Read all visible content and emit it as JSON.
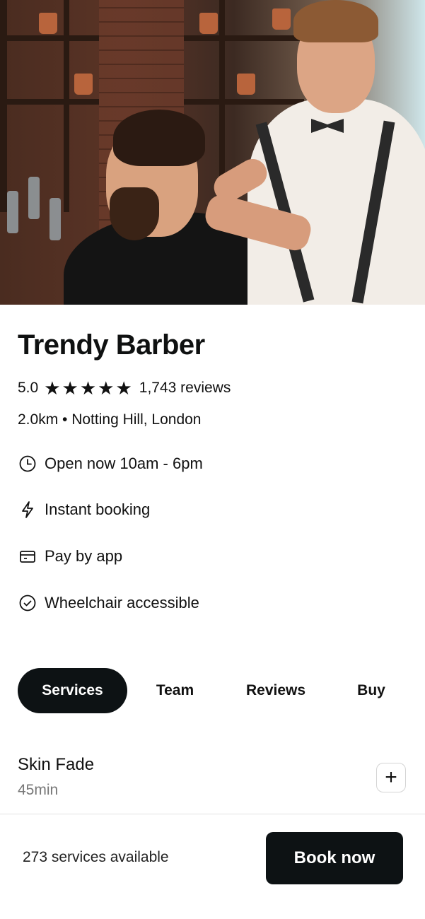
{
  "hero": {
    "alt_description": "",
    "icon": "barber-photo"
  },
  "shop": {
    "name": "Trendy Barber",
    "rating": "5.0",
    "stars": 5,
    "reviews": "1,743 reviews",
    "location": "2.0km • Notting Hill, London"
  },
  "features": [
    {
      "icon": "clock-icon",
      "label": "Open now 10am - 6pm"
    },
    {
      "icon": "lightning-icon",
      "label": "Instant booking"
    },
    {
      "icon": "wallet-icon",
      "label": "Pay by app"
    },
    {
      "icon": "check-circle-icon",
      "label": "Wheelchair accessible"
    }
  ],
  "tabs": [
    {
      "label": "Services",
      "active": true
    },
    {
      "label": "Team",
      "active": false
    },
    {
      "label": "Reviews",
      "active": false
    },
    {
      "label": "Buy",
      "active": false
    }
  ],
  "service": {
    "name": "Skin Fade",
    "duration": "45min"
  },
  "footer": {
    "available": "273 services available",
    "book_label": "Book now"
  },
  "colors": {
    "primary": "#0d1214",
    "muted": "#777777",
    "divider": "#e2e2e2"
  }
}
